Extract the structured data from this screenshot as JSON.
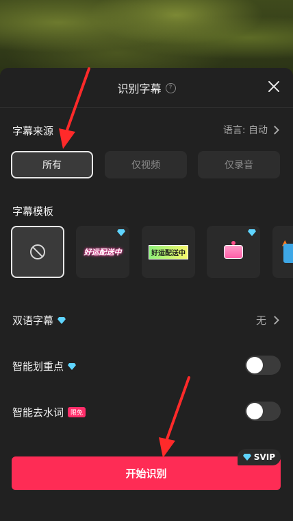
{
  "dialog": {
    "title": "识别字幕",
    "help_icon": "help-circle-icon",
    "close_icon": "close-icon"
  },
  "subtitle_source": {
    "label": "字幕来源",
    "language_label": "语言: 自动",
    "options": [
      "所有",
      "仅视频",
      "仅录音"
    ],
    "selected": "所有"
  },
  "subtitle_template": {
    "label": "字幕模板",
    "items": [
      {
        "type": "none",
        "icon": "no-template-icon",
        "selected": true
      },
      {
        "text": "好运配送中",
        "vip": true
      },
      {
        "text": "好运配送中",
        "vip": false
      },
      {
        "icon": "sticker-template-icon",
        "vip": true
      },
      {
        "icon": "flame-icon",
        "vip": false
      }
    ]
  },
  "bilingual": {
    "label": "双语字幕",
    "value": "无",
    "vip_icon": "diamond-icon"
  },
  "smart_highlight": {
    "label": "智能划重点",
    "enabled": false,
    "vip_icon": "diamond-icon"
  },
  "smart_filler": {
    "label": "智能去水词",
    "badge": "限免",
    "enabled": false
  },
  "svip_badge": "SVIP",
  "start_button": "开始识别",
  "colors": {
    "accent": "#fe2c55",
    "sheet_bg": "#212121",
    "arrow": "#ff2a2a"
  }
}
